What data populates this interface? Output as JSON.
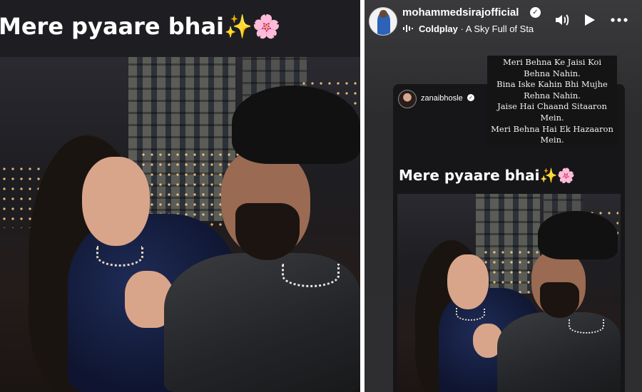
{
  "left_story": {
    "title": "Mere pyaare bhai",
    "title_emojis": "✨🌸"
  },
  "right_story": {
    "header": {
      "username": "mohammedsirajofficial",
      "verified": true,
      "music_artist": "Coldplay",
      "music_separator": "·",
      "music_track": "A Sky Full of Sta",
      "icons": [
        "volume-icon",
        "play-icon",
        "more-icon"
      ]
    },
    "poem_lines": [
      "Meri Behna Ke Jaisi Koi",
      "Behna Nahin.",
      "Bina Iske Kahin Bhi Mujhe",
      "Rehna Nahin.",
      "Jaise Hai Chaand Sitaaron",
      "Mein.",
      "Meri Behna Hai Ek Hazaaron",
      "Mein."
    ],
    "reshared_story": {
      "username": "zanaibhosle",
      "verified": true,
      "title": "Mere pyaare bhai",
      "title_emojis": "✨🌸"
    }
  },
  "colors": {
    "background_dark": "#1b1b1f",
    "story_bg": "#2e2e31",
    "text": "#ffffff",
    "divider": "#ffffff"
  }
}
